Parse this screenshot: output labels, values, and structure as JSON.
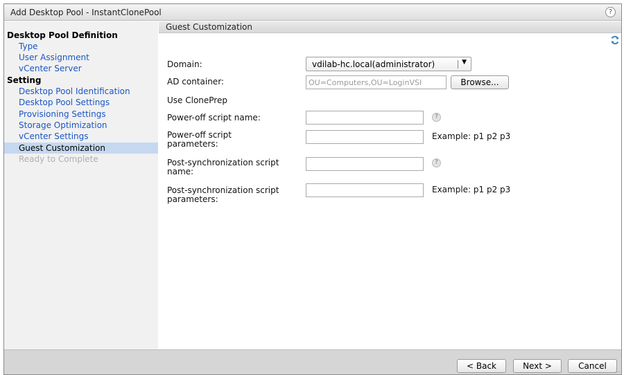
{
  "window": {
    "title": "Add Desktop Pool - InstantClonePool",
    "help_glyph": "?"
  },
  "nav": {
    "items": [
      {
        "label": "Desktop Pool Definition",
        "kind": "head"
      },
      {
        "label": "Type",
        "kind": "link"
      },
      {
        "label": "User Assignment",
        "kind": "link"
      },
      {
        "label": "vCenter Server",
        "kind": "link"
      },
      {
        "label": "Setting",
        "kind": "head"
      },
      {
        "label": "Desktop Pool Identification",
        "kind": "link"
      },
      {
        "label": "Desktop Pool Settings",
        "kind": "link"
      },
      {
        "label": "Provisioning Settings",
        "kind": "link"
      },
      {
        "label": "Storage Optimization",
        "kind": "link"
      },
      {
        "label": "vCenter Settings",
        "kind": "link"
      },
      {
        "label": "Guest Customization",
        "kind": "selected"
      },
      {
        "label": "Ready to Complete",
        "kind": "disabled"
      }
    ]
  },
  "section": {
    "title": "Guest Customization",
    "refresh_icon": "refresh-icon"
  },
  "form": {
    "domain_label": "Domain:",
    "domain_value": "vdilab-hc.local(administrator)",
    "ad_container_label": "AD container:",
    "ad_container_value": "OU=Computers,OU=LoginVSI",
    "browse_label": "Browse...",
    "use_cloneprep_label": "Use ClonePrep",
    "poweroff_name_label": "Power-off script name:",
    "poweroff_name_value": "",
    "poweroff_params_label_1": "Power-off script",
    "poweroff_params_label_2": "parameters:",
    "poweroff_params_value": "",
    "poweroff_example": "Example: p1 p2 p3",
    "postsync_name_label_1": "Post-synchronization script",
    "postsync_name_label_2": "name:",
    "postsync_name_value": "",
    "postsync_params_label_1": "Post-synchronization script",
    "postsync_params_label_2": "parameters:",
    "postsync_params_value": "",
    "postsync_example": "Example: p1 p2 p3",
    "help_glyph": "?"
  },
  "footer": {
    "back_label": "< Back",
    "next_label": "Next >",
    "cancel_label": "Cancel"
  },
  "colors": {
    "nav_link": "#1a56c4",
    "nav_selected_bg": "#c5d8f0",
    "footer_bg": "#d6d6d6"
  }
}
